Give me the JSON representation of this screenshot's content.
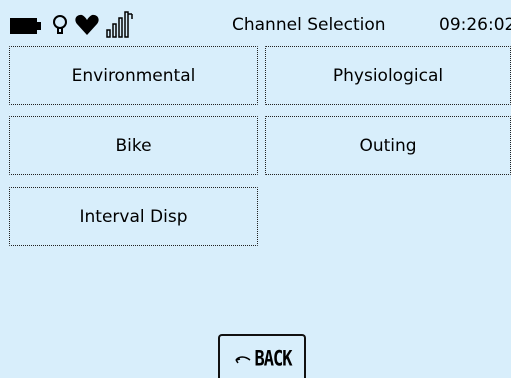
{
  "status_bar": {
    "icons": [
      "battery-icon",
      "bulb-icon",
      "heart-icon",
      "signal-icon"
    ],
    "title": "Channel Selection",
    "time": "09:26:02"
  },
  "menu": {
    "environmental": "Environmental",
    "physiological": "Physiological",
    "bike": "Bike",
    "outing": "Outing",
    "interval_disp": "Interval Disp"
  },
  "back_button": {
    "label": "BACK",
    "icon": "back-arrow-icon"
  },
  "colors": {
    "background": "#d8eefb",
    "foreground": "#000000"
  }
}
